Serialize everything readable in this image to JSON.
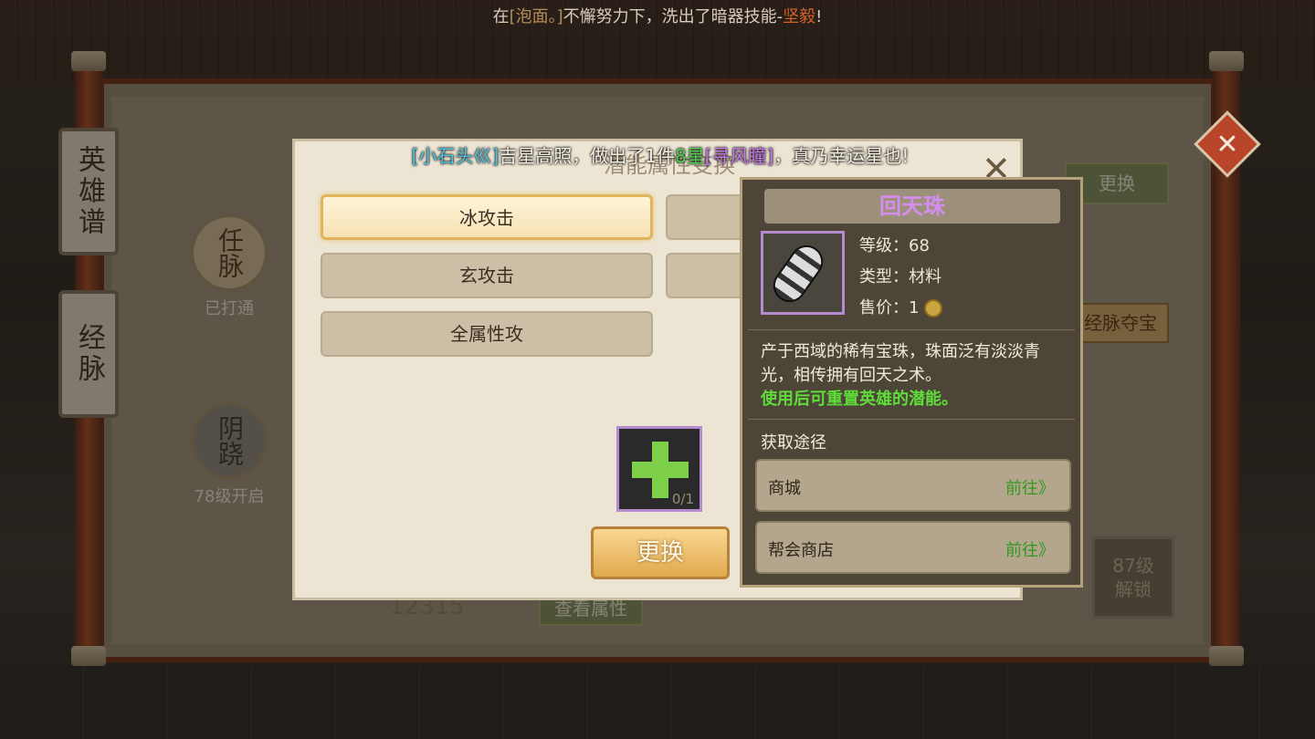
{
  "broadcast": {
    "prefix": "在",
    "player": "[泡面。]",
    "middle": "不懈努力下，洗出了暗器技能-",
    "skill": "坚毅",
    "suffix": "!"
  },
  "side_tabs": [
    "英雄谱",
    "经脉"
  ],
  "nodes": [
    {
      "label": "任脉",
      "caption": "已打通"
    },
    {
      "label": "阴跷",
      "caption": "78级开启"
    }
  ],
  "background": {
    "change_label": "更换",
    "treasure_label": "经脉夺宝",
    "view_attr_label": "查看属性",
    "power_value": "12315",
    "lock_text": "87级\n解锁"
  },
  "dialog": {
    "title": "潜能属性变换",
    "notice": {
      "player": "[小石头巛]",
      "text1": "吉星高照，做出了1件",
      "star": "8星",
      "item": "[寻风瞳]",
      "text2": "，真乃幸运星也!"
    },
    "options": [
      "冰攻击",
      "玄攻击",
      "全属性攻"
    ],
    "selected_option": "冰攻击",
    "slot_count": "0/1",
    "change_button": "更换"
  },
  "tooltip": {
    "name": "回天珠",
    "level_label": "等级：",
    "level": "68",
    "type_label": "类型：",
    "type": "材料",
    "price_label": "售价：",
    "price": "1",
    "desc": "产于西域的稀有宝珠，珠面泛有淡淡青光，相传拥有回天之术。",
    "desc_highlight": "使用后可重置英雄的潜能。",
    "source_title": "获取途径",
    "sources": [
      {
        "name": "商城",
        "action": "前往》"
      },
      {
        "name": "帮会商店",
        "action": "前往》"
      }
    ]
  },
  "colors": {
    "item_name": "#d58df0",
    "highlight_green": "#5fdc3a",
    "player_name": "#4fc3e0"
  }
}
